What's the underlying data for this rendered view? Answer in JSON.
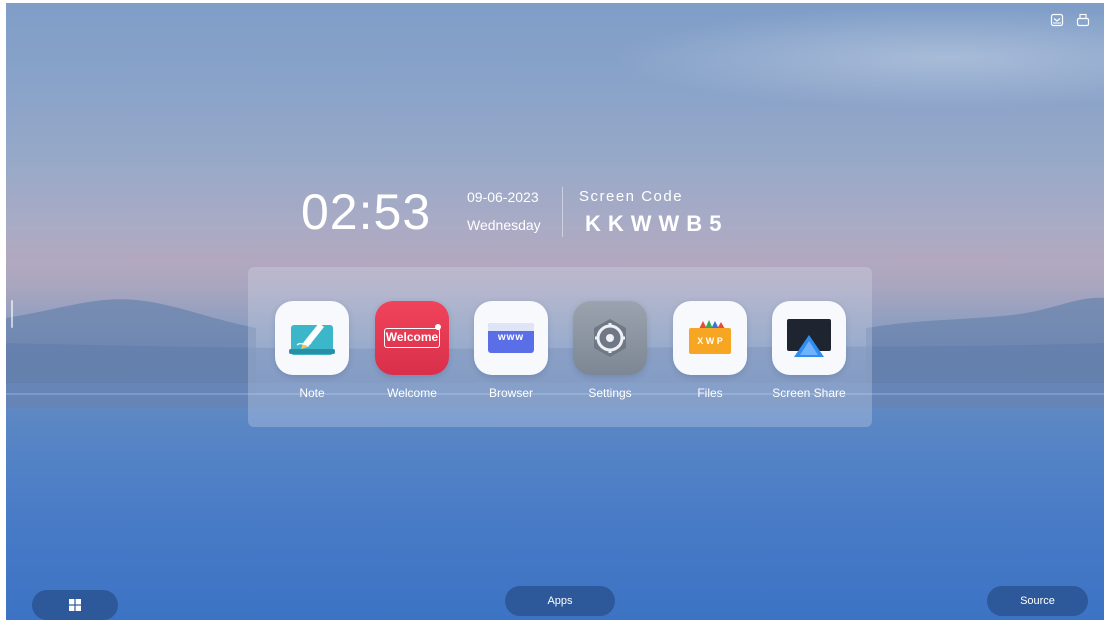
{
  "clock": {
    "time": "02:53",
    "date": "09-06-2023",
    "weekday": "Wednesday"
  },
  "screen_code": {
    "label": "Screen Code",
    "value": "KKWWB5"
  },
  "apps": [
    {
      "label": "Note",
      "icon": "note-icon"
    },
    {
      "label": "Welcome",
      "icon": "welcome-icon",
      "icon_text": "Welcome"
    },
    {
      "label": "Browser",
      "icon": "browser-icon",
      "icon_text": "www"
    },
    {
      "label": "Settings",
      "icon": "gear-icon"
    },
    {
      "label": "Files",
      "icon": "files-icon",
      "icon_text": "X W P"
    },
    {
      "label": "Screen Share",
      "icon": "screen-share-icon"
    }
  ],
  "taskbar": {
    "apps_label": "Apps",
    "source_label": "Source",
    "windows_icon": "windows-icon"
  },
  "top_icons": [
    "inbox-icon",
    "printer-icon"
  ],
  "colors": {
    "button_bg": "#2d5899",
    "welcome_red": "#e8384f",
    "settings_grey": "#8a93a0"
  }
}
